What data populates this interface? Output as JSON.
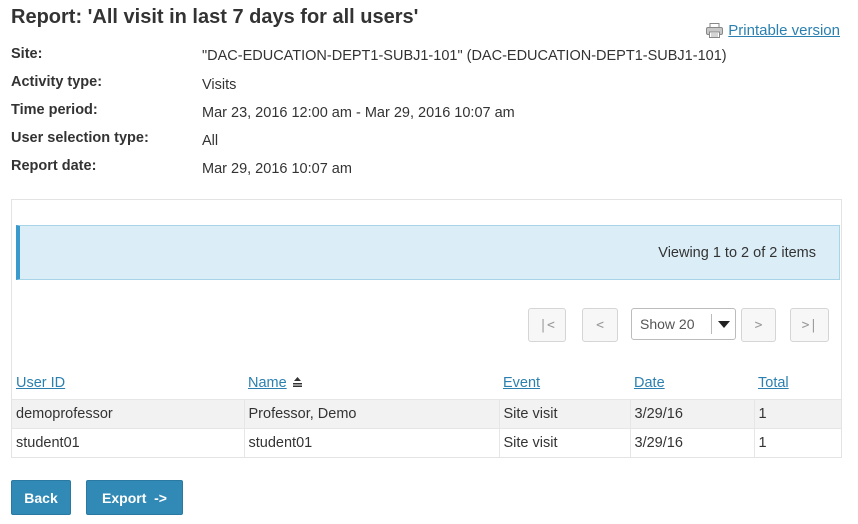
{
  "title": "Report: 'All visit in last 7 days for all users'",
  "printable_label": "Printable version",
  "meta": [
    {
      "label": "Site:",
      "value": "\"DAC-EDUCATION-DEPT1-SUBJ1-101\" (DAC-EDUCATION-DEPT1-SUBJ1-101)"
    },
    {
      "label": "Activity type:",
      "value": "Visits"
    },
    {
      "label": "Time period:",
      "value": "Mar 23, 2016 12:00 am - Mar 29, 2016 10:07 am"
    },
    {
      "label": "User selection type:",
      "value": "All"
    },
    {
      "label": "Report date:",
      "value": "Mar 29, 2016 10:07 am"
    }
  ],
  "viewing_text": "Viewing 1 to 2 of 2 items",
  "pager": {
    "first": "|<",
    "prev": "<",
    "next": ">",
    "last": ">|",
    "page_size": "Show 20"
  },
  "table": {
    "headers": [
      "User ID",
      "Name",
      "Event",
      "Date",
      "Total"
    ],
    "rows": [
      [
        "demoprofessor",
        "Professor, Demo",
        "Site visit",
        "3/29/16",
        "1"
      ],
      [
        "student01",
        "student01",
        "Site visit",
        "3/29/16",
        "1"
      ]
    ]
  },
  "buttons": {
    "back": "Back",
    "export": "Export  ->"
  },
  "colors": {
    "link": "#2b80b0",
    "button": "#3189b6",
    "info_bg": "#dbeef7",
    "info_border": "#3a9acc"
  }
}
